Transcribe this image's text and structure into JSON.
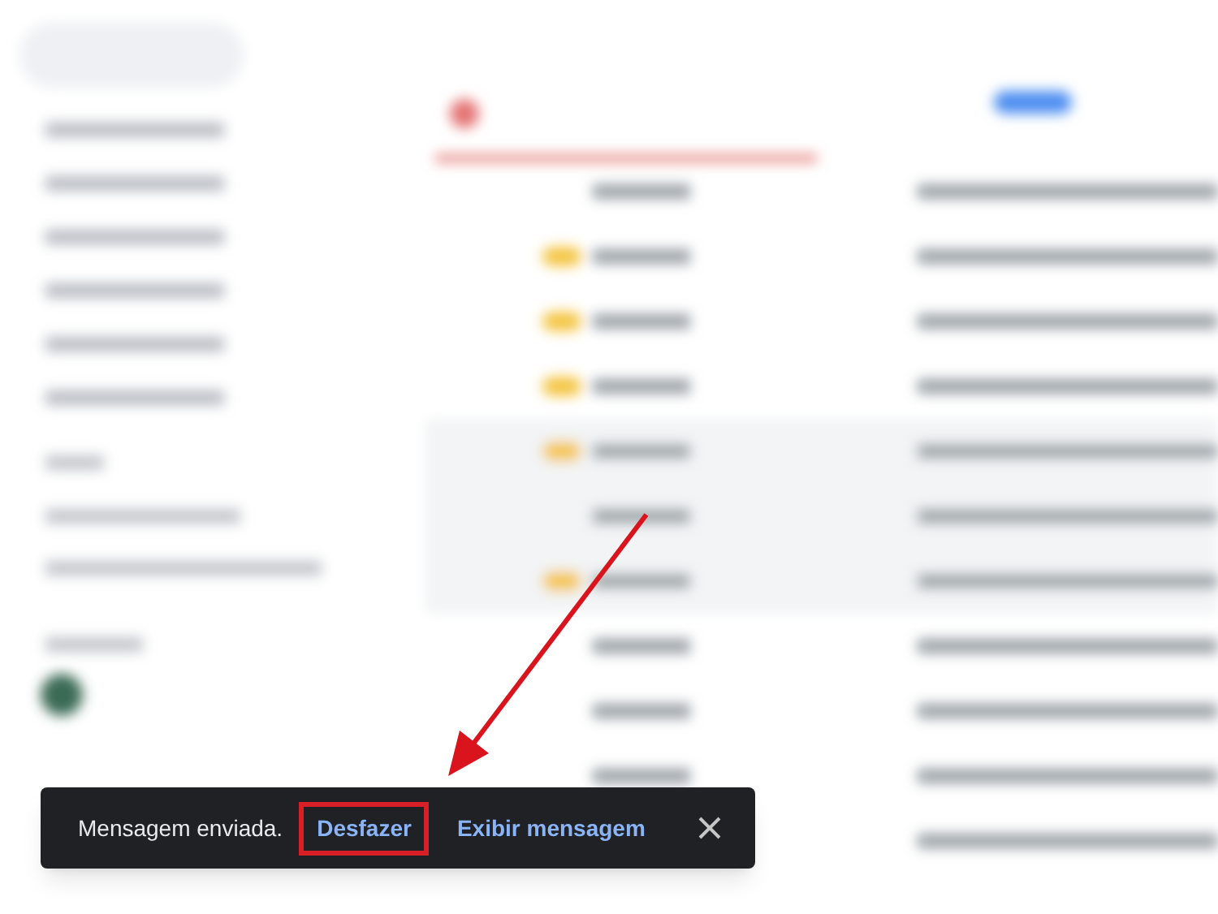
{
  "snackbar": {
    "message": "Mensagem enviada.",
    "actions": [
      {
        "label": "Desfazer",
        "highlighted": true
      },
      {
        "label": "Exibir mensagem",
        "highlighted": false
      }
    ]
  }
}
